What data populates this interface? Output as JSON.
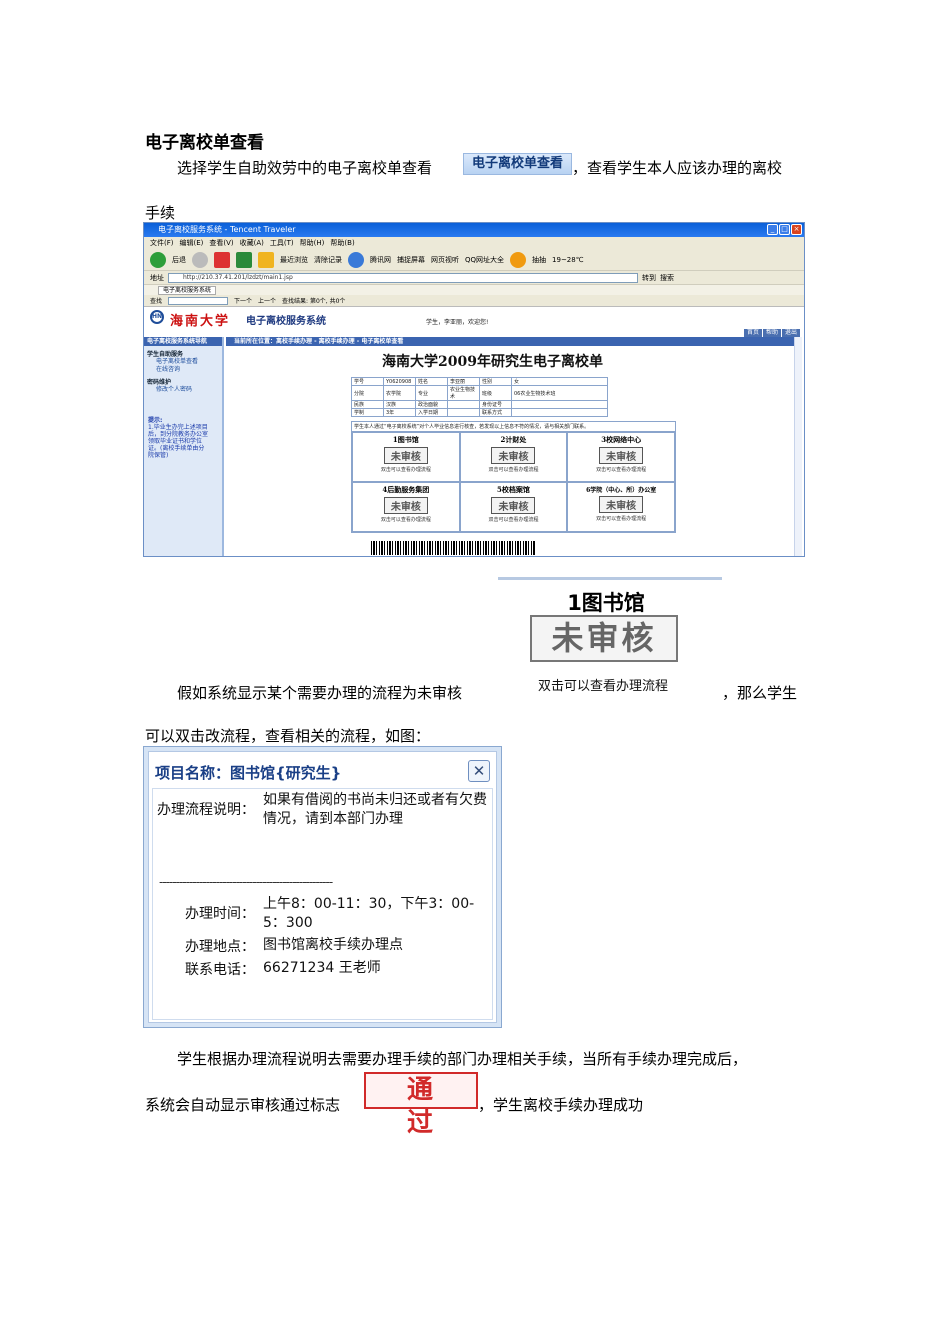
{
  "heading": "电子离校单查看",
  "para1": {
    "before": "选择学生自助效劳中的电子离校单查看",
    "button_label": "电子离校单查看",
    "after": "，查看学生本人应该办理的离校",
    "wrap": "手续"
  },
  "browser": {
    "title": "电子离校服务系统 - Tencent Traveler",
    "menu": [
      "文件(F)",
      "编辑(E)",
      "查看(V)",
      "收藏(A)",
      "工具(T)",
      "帮助(H)",
      "帮助(B)"
    ],
    "toolbar": [
      "后退",
      "最近浏览",
      "清除记录",
      "腾讯网",
      "捕捉屏幕",
      "网页视听",
      "QQ网址大全",
      "抽抽"
    ],
    "weather": "19~28℃",
    "address_label": "地址",
    "address": "http://210.37.41.201/lzdzt/main1.jsp",
    "go_label": "转到",
    "search_label": "搜索",
    "tab": "电子离校服务系统",
    "find": {
      "label": "查找",
      "next": "下一个",
      "prev": "上一个",
      "result": "查找结果: 第0个, 共0个"
    },
    "university": "海南大学",
    "system_name": "电子离校服务系统",
    "welcome": "学生，李亚丽，欢迎您!",
    "nav_links": [
      "首页",
      "帮助",
      "退出"
    ],
    "left_header": "电子离校服务系统导航",
    "left_section1": "学生自助服务",
    "left_items1": [
      "电子离校单查看",
      "在线咨询"
    ],
    "left_section2": "密码维护",
    "left_items2": [
      "修改个人密码"
    ],
    "hint_title": "提示:",
    "hint_text": "1.毕业生办完上述项目后，到分院教务办公室领取毕业证书和学位证。(离校手续单由分院保管)",
    "breadcrumb": "当前所在位置：离校手续办理 - 离校手续办理 - 电子离校单查看",
    "form_title": "海南大学2009年研究生电子离校单",
    "info_rows": [
      [
        "学号",
        "Y0620908",
        "姓名",
        "李亚丽",
        "性别",
        "女"
      ],
      [
        "分院",
        "农学院",
        "专业",
        "农业生物技术",
        "班级",
        "06农业生物技术班"
      ],
      [
        "民族",
        "汉族",
        "政治面貌",
        "",
        "身份证号",
        ""
      ],
      [
        "学制",
        "3年",
        "入学日期",
        "",
        "联系方式",
        ""
      ]
    ],
    "notice": "学生本人通过“电子离校系统”对个人毕业信息进行核查，若发现以上信息不符的情况，请与相关部门联系。",
    "departments": [
      "1图书馆",
      "2计财处",
      "3校网络中心",
      "4后勤服务集团",
      "5校档案馆",
      "6学院（中心、所）办公室"
    ],
    "status": "未审核",
    "cell_link": "双击可以查看办理流程"
  },
  "zoom": {
    "dept": "1图书馆",
    "status": "未审核",
    "link": "双击可以查看办理流程"
  },
  "para2": {
    "before": "假如系统显示某个需要办理的流程为未审核",
    "after": "，那么学生",
    "line2": "可以双击改流程，查看相关的流程，如图："
  },
  "popup": {
    "title": "项目名称：图书馆{研究生}",
    "desc_label": "办理流程说明：",
    "desc_value": "如果有借阅的书尚未归还或者有欠费情况，请到本部门办理",
    "divider": "----------------------------------------------------",
    "time_label": "办理时间：",
    "time_value": "上午8：00-11：30，下午3：00-5：300",
    "place_label": "办理地点：",
    "place_value": "图书馆离校手续办理点",
    "phone_label": "联系电话：",
    "phone_value": "66271234 王老师"
  },
  "para3": {
    "line1": "学生根据办理流程说明去需要办理手续的部门办理相关手续，当所有手续办理完成后，",
    "before": "系统会自动显示审核通过标志",
    "stamp": "通 过",
    "after": "，学生离校手续办理成功"
  }
}
